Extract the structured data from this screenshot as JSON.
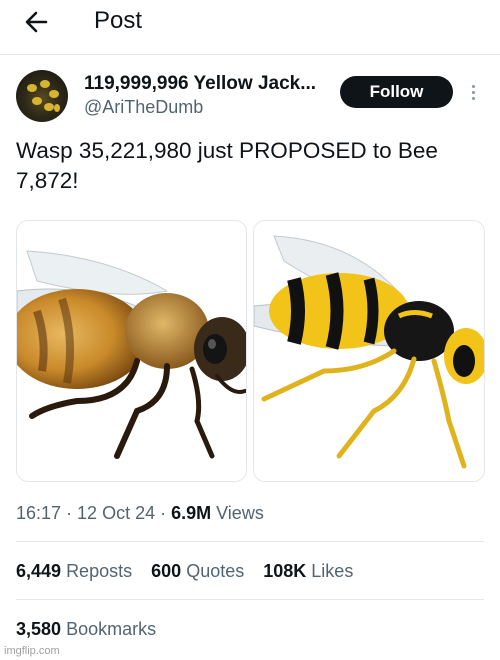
{
  "header": {
    "back_icon": "arrow-left-icon",
    "title": "Post"
  },
  "author": {
    "display_name": "119,999,996 Yellow Jack...",
    "handle": "@AriTheDumb",
    "avatar": "wasp-nest-avatar"
  },
  "actions": {
    "follow_label": "Follow",
    "more_icon": "more-vertical-icon"
  },
  "post": {
    "text": "Wasp 35,221,980 just PROPOSED to Bee 7,872!",
    "media": [
      {
        "subject": "honeybee-photo"
      },
      {
        "subject": "yellow-jacket-wasp-photo"
      }
    ]
  },
  "meta": {
    "time": "16:17",
    "sep1": " · ",
    "date": "12 Oct 24",
    "sep2": " · ",
    "views_count": "6.9M",
    "views_label": " Views"
  },
  "stats": {
    "reposts_count": "6,449",
    "reposts_label": "Reposts",
    "quotes_count": "600",
    "quotes_label": "Quotes",
    "likes_count": "108K",
    "likes_label": "Likes",
    "bookmarks_count": "3,580",
    "bookmarks_label": "Bookmarks"
  },
  "watermark": "imgflip.com",
  "colors": {
    "text_primary": "#0f1419",
    "text_secondary": "#536471",
    "divider": "#e6e6e6",
    "follow_bg": "#0f1419",
    "follow_text": "#ffffff"
  }
}
